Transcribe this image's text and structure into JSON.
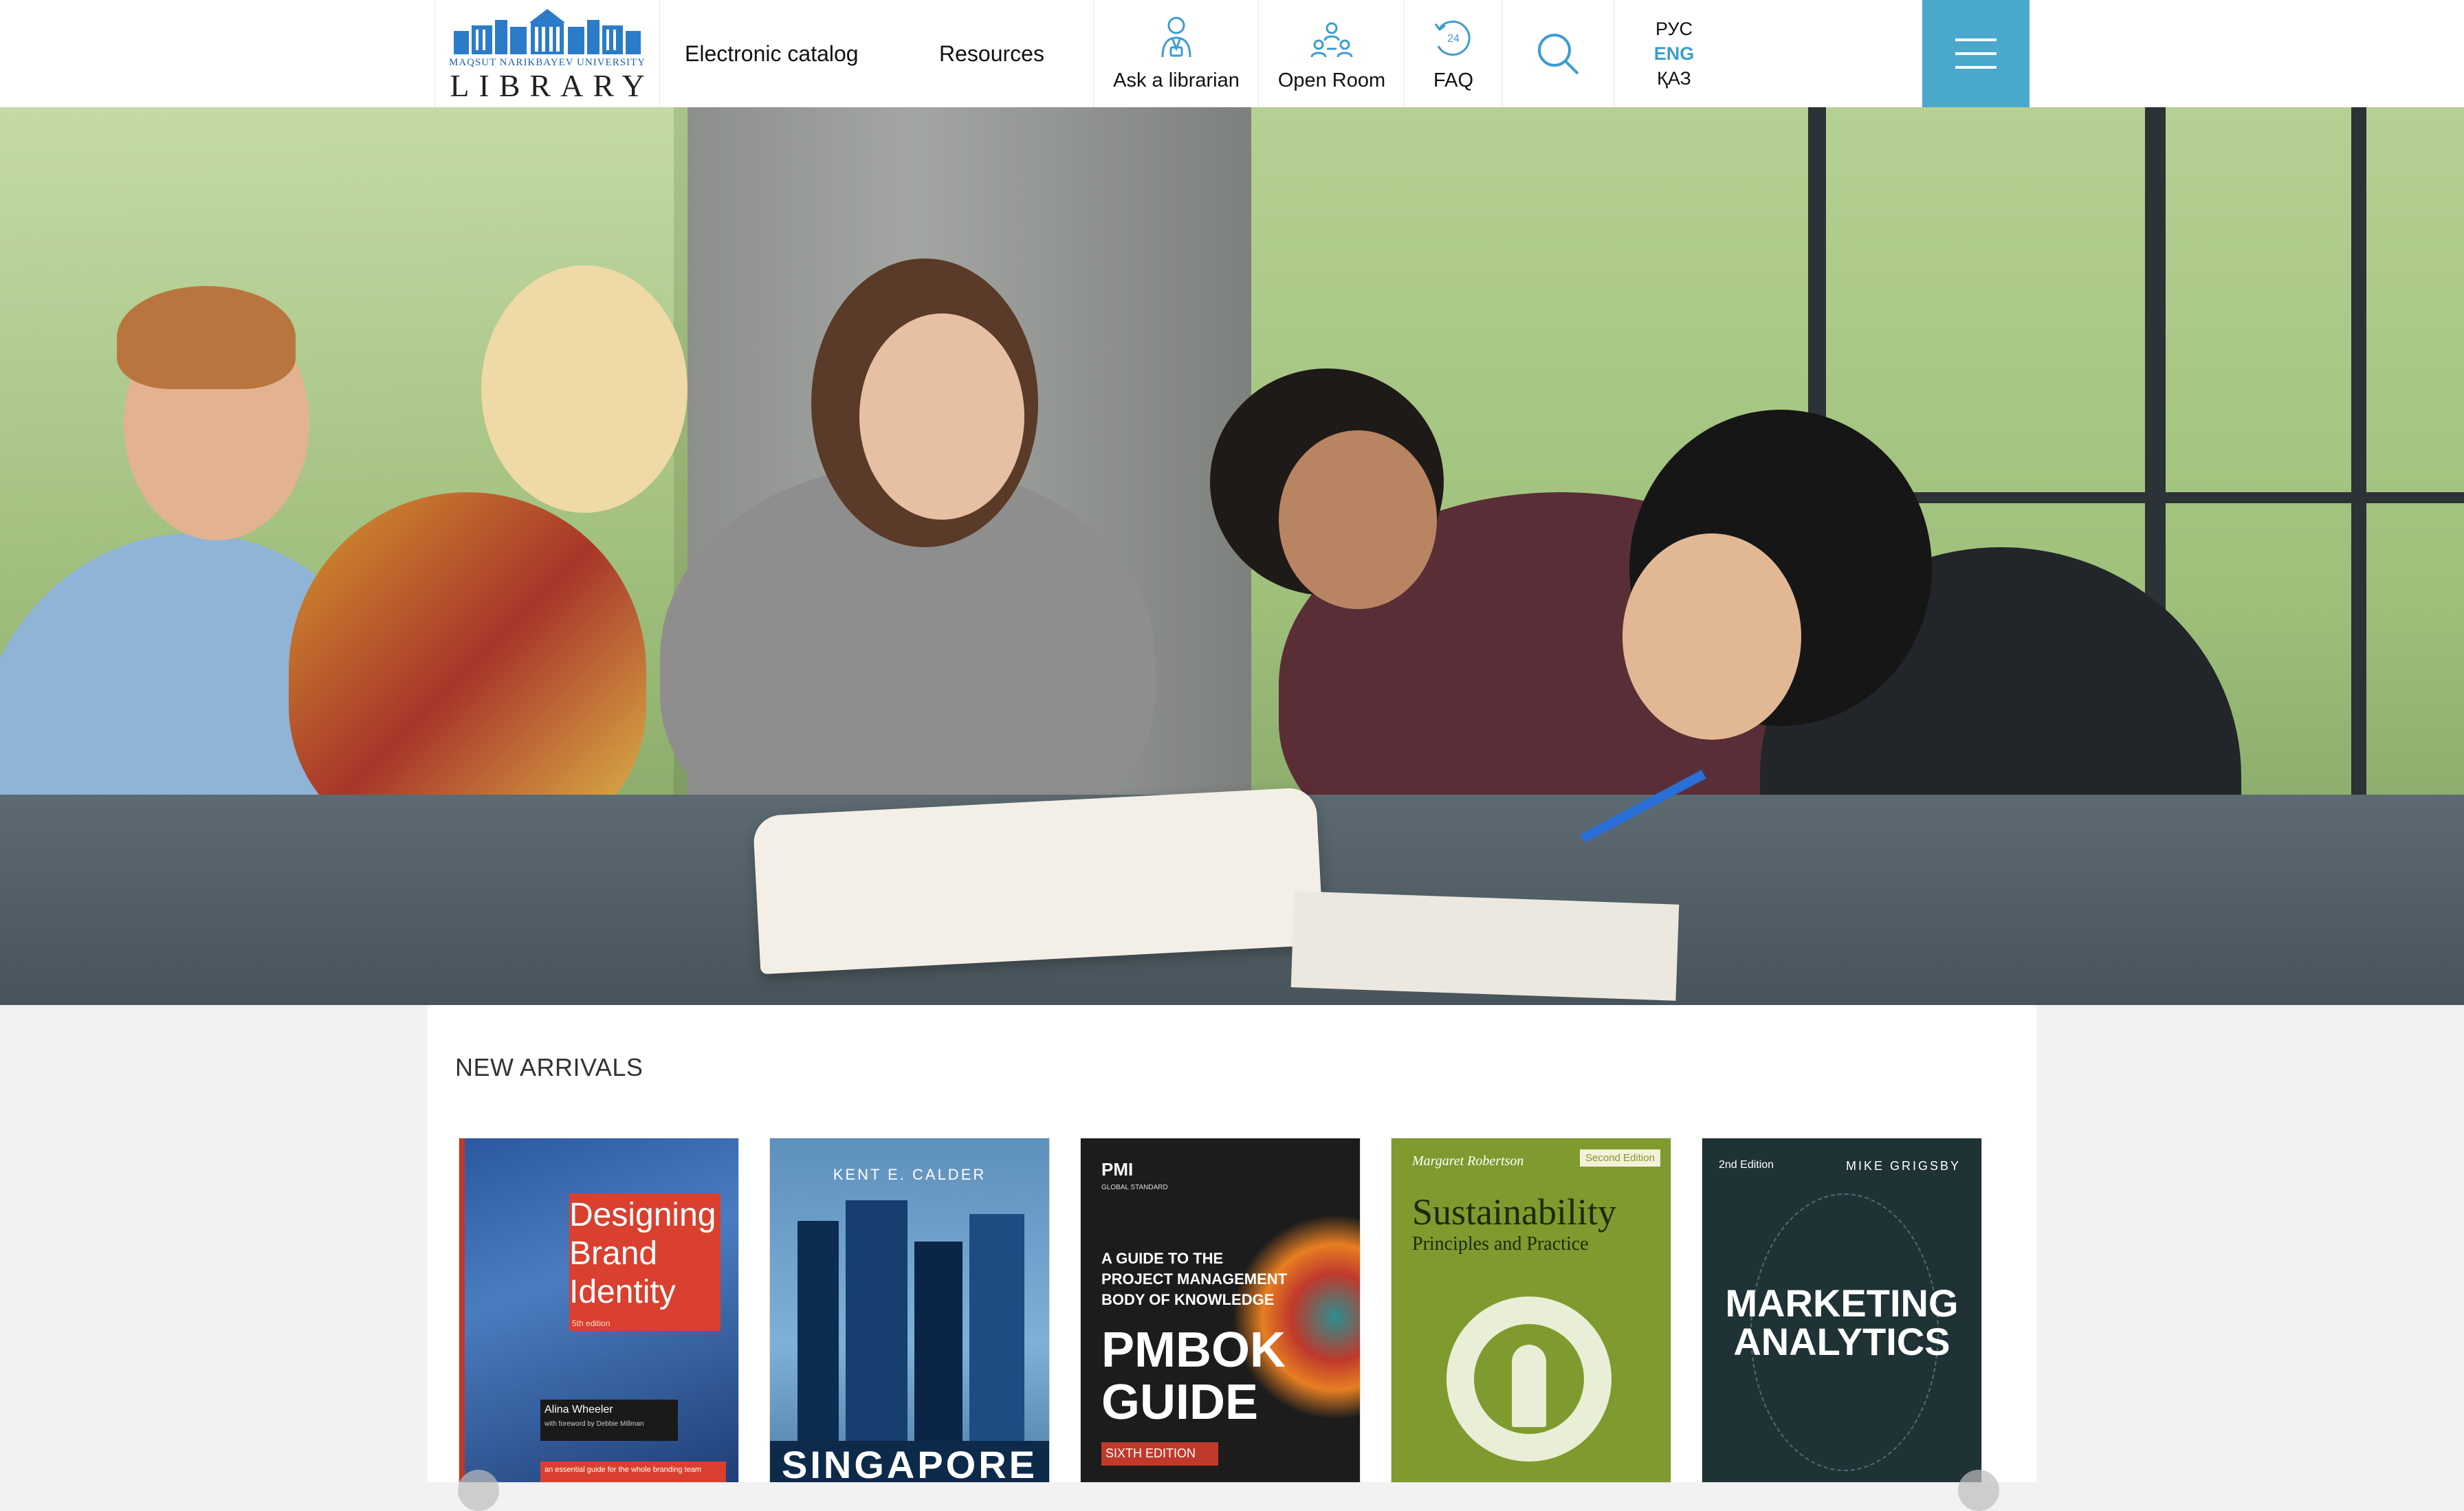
{
  "header": {
    "logo": {
      "subtitle": "MAQSUT NARIKBAYEV UNIVERSITY",
      "title": "LIBRARY"
    },
    "nav": {
      "electronic_catalog": "Electronic catalog",
      "resources": "Resources",
      "ask_librarian": "Ask a librarian",
      "open_room": "Open Room",
      "faq": "FAQ",
      "faq_badge": "24"
    },
    "languages": [
      "РУС",
      "ENG",
      "ҚАЗ"
    ],
    "active_language": "ENG"
  },
  "new_arrivals": {
    "title": "NEW ARRIVALS",
    "books": [
      {
        "title_lines": [
          "Designing",
          "Brand",
          "Identity"
        ],
        "edition": "5th edition",
        "author": "Alina Wheeler",
        "foreword": "with foreword by Debbie Millman",
        "tagline": "an essential guide for the whole branding team",
        "color": "#2b4f8c"
      },
      {
        "author": "KENT E. CALDER",
        "title": "SINGAPORE",
        "color": "#6fa0c8"
      },
      {
        "publisher": "PMI",
        "label": "GLOBAL STANDARD",
        "subtitle_lines": [
          "A GUIDE TO THE",
          "PROJECT MANAGEMENT",
          "BODY OF KNOWLEDGE"
        ],
        "title_lines": [
          "PMBOK",
          "GUIDE"
        ],
        "edition": "SIXTH EDITION",
        "color": "#1f1f1f"
      },
      {
        "author": "Margaret Robertson",
        "edition": "Second Edition",
        "title": "Sustainability",
        "subtitle": "Principles and Practice",
        "color": "#7f9a2e"
      },
      {
        "edition": "2nd Edition",
        "author": "MIKE GRIGSBY",
        "title_lines": [
          "MARKETING",
          "ANALYTICS"
        ],
        "color": "#1f3236"
      }
    ]
  },
  "colors": {
    "accent": "#4aa8cc",
    "active_lang": "#3b9dd0",
    "logo_blue": "#1f5fa8"
  }
}
